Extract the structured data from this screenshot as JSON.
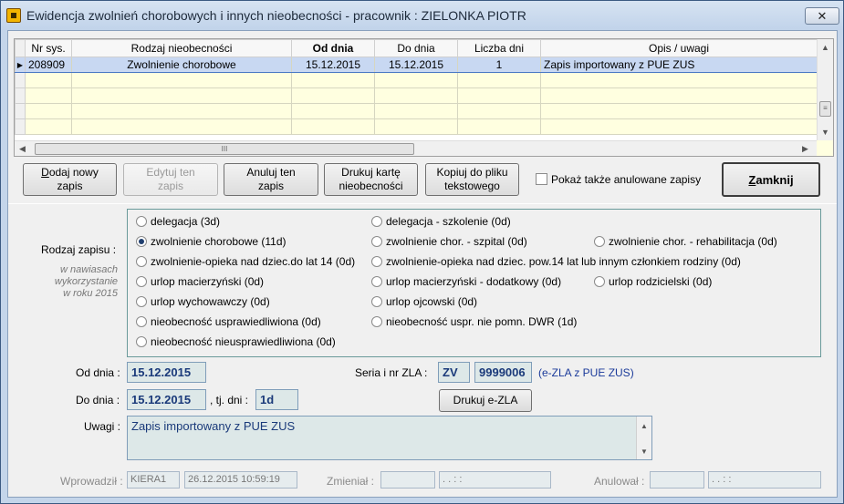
{
  "window": {
    "title": "Ewidencja zwolnień chorobowych i innych nieobecności - pracownik : ZIELONKA PIOTR",
    "close_label": "✕"
  },
  "grid": {
    "columns": [
      "Nr sys.",
      "Rodzaj nieobecności",
      "Od dnia",
      "Do dnia",
      "Liczba dni",
      "Opis / uwagi"
    ],
    "rows": [
      {
        "nr": "208909",
        "rodzaj": "Zwolnienie chorobowe",
        "od": "15.12.2015",
        "do": "15.12.2015",
        "dni": "1",
        "opis": "Zapis importowany z PUE ZUS"
      }
    ],
    "row_indicator": "▶",
    "hscroll_grip": "III",
    "vscroll_grip": "≡"
  },
  "toolbar": {
    "add": [
      "Dodaj nowy",
      "zapis"
    ],
    "add_underline": "D",
    "add_rest": "odaj nowy",
    "edit": [
      "Edytuj ten",
      "zapis"
    ],
    "cancel": [
      "Anuluj ten",
      "zapis"
    ],
    "print_card": [
      "Drukuj kartę",
      "nieobecności"
    ],
    "copy": [
      "Kopiuj do pliku",
      "tekstowego"
    ],
    "show_cancelled": "Pokaż także anulowane zapisy",
    "close": "Zamknij",
    "close_underline": "Z",
    "close_rest": "amknij"
  },
  "form": {
    "type_label": "Rodzaj zapisu :",
    "type_note": [
      "w nawiasach",
      "wykorzystanie",
      "w roku 2015"
    ],
    "options": [
      {
        "label": "delegacja (3d)",
        "selected": false
      },
      {
        "label": "zwolnienie chorobowe (11d)",
        "selected": true
      },
      {
        "label": "zwolnienie-opieka nad dziec.do lat 14 (0d)",
        "selected": false
      },
      {
        "label": "urlop macierzyński (0d)",
        "selected": false
      },
      {
        "label": "urlop wychowawczy (0d)",
        "selected": false
      },
      {
        "label": "nieobecność usprawiedliwiona (0d)",
        "selected": false
      },
      {
        "label": "nieobecność nieusprawiedliwiona (0d)",
        "selected": false
      },
      {
        "label": "delegacja - szkolenie (0d)",
        "selected": false
      },
      {
        "label": "zwolnienie chor. - szpital (0d)",
        "selected": false
      },
      {
        "label": "zwolnienie-opieka nad dziec. pow.14 lat lub innym członkiem rodziny (0d)",
        "selected": false
      },
      {
        "label": "urlop macierzyński - dodatkowy (0d)",
        "selected": false
      },
      {
        "label": "urlop ojcowski (0d)",
        "selected": false
      },
      {
        "label": "nieobecność uspr. nie pomn. DWR (1d)",
        "selected": false
      },
      {
        "label": "zwolnienie chor. - rehabilitacja (0d)",
        "selected": false
      },
      {
        "label": "urlop rodzicielski (0d)",
        "selected": false
      }
    ],
    "from_label": "Od dnia :",
    "from_value": "15.12.2015",
    "to_label": "Do dnia :",
    "to_value": "15.12.2015",
    "days_label": ", tj. dni :",
    "days_value": "1d",
    "zla_label": "Seria i nr ZLA :",
    "zla_series": "ZV",
    "zla_number": "9999006",
    "zla_note": "(e-ZLA z PUE ZUS)",
    "print_zla": "Drukuj e-ZLA",
    "remarks_label": "Uwagi :",
    "remarks_value": "Zapis importowany z PUE ZUS"
  },
  "footer": {
    "entered_label": "Wprowadził :",
    "entered_user": "KIERA1",
    "entered_date": "26.12.2015 10:59:19",
    "changed_label": "Zmieniał :",
    "changed_user": "",
    "changed_date": ". .   : :",
    "cancelled_label": "Anulował :",
    "cancelled_user": "",
    "cancelled_date": ". .   : :"
  }
}
